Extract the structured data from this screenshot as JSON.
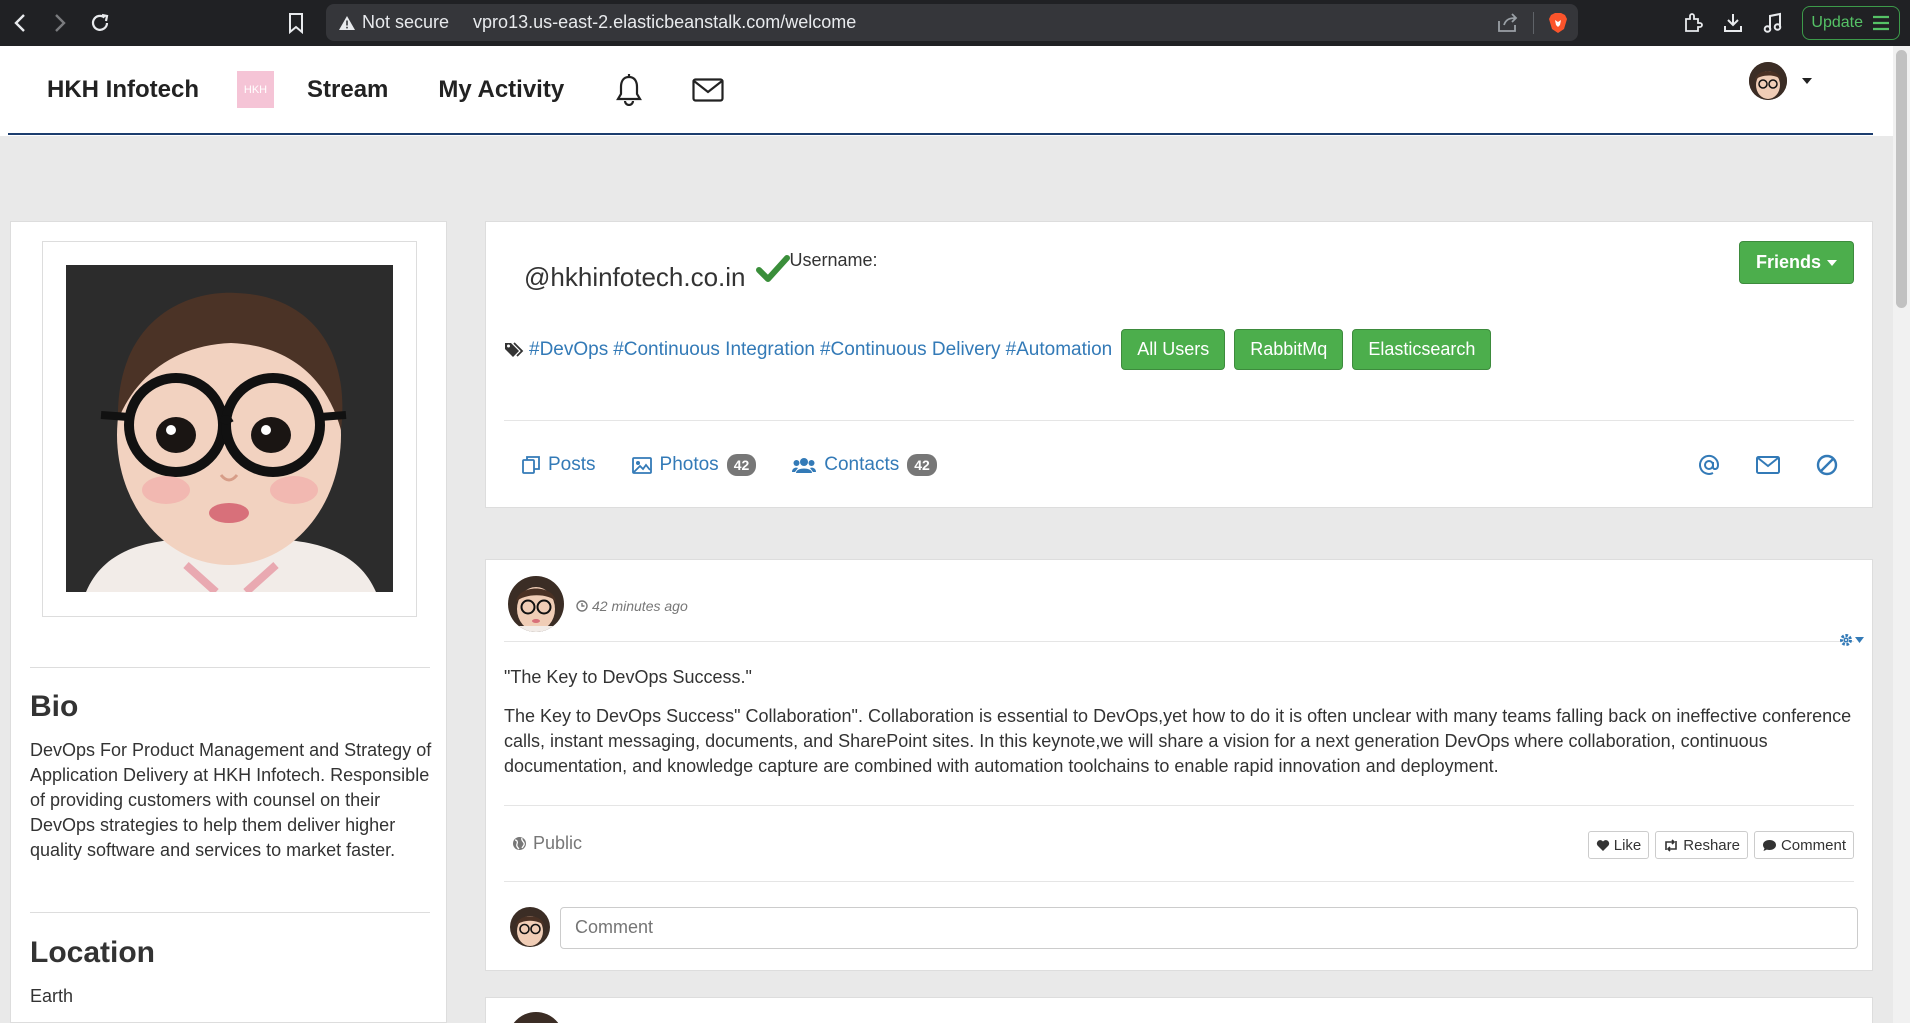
{
  "browser": {
    "security_label": "Not secure",
    "url_host": "vpro13.us-east-2.elasticbeanstalk.com",
    "url_path": "/welcome",
    "update_label": "Update"
  },
  "nav": {
    "brand": "HKH Infotech",
    "logo_text": "HKH",
    "stream": "Stream",
    "my_activity": "My Activity"
  },
  "bio": {
    "title": "Bio",
    "text": "DevOps For Product Management and Strategy of Application Delivery at HKH Infotech. Responsible of providing customers with counsel on their DevOps strategies to help them deliver higher quality software and services to market faster."
  },
  "location": {
    "title": "Location",
    "value": "Earth"
  },
  "profile": {
    "handle": "@hkhinfotech.co.in",
    "username_label": "Username:",
    "friends_button": "Friends",
    "tags": [
      "#DevOps",
      "#Continuous Integration",
      "#Continuous Delivery",
      "#Automation"
    ],
    "aspects": [
      "All Users",
      "RabbitMq",
      "Elasticsearch"
    ],
    "tabs": {
      "posts": "Posts",
      "photos": "Photos",
      "photos_count": "42",
      "contacts": "Contacts",
      "contacts_count": "42"
    }
  },
  "post": {
    "time": "42 minutes ago",
    "title": "\"The Key to DevOps Success.\"",
    "body": "The Key to DevOps Success\" Collaboration\". Collaboration is essential to DevOps,yet how to do it is often unclear with many teams falling back on ineffective conference calls, instant messaging, documents, and SharePoint sites. In this keynote,we will share a vision for a next generation DevOps where collaboration, continuous documentation, and knowledge capture are combined with automation toolchains to enable rapid innovation and deployment.",
    "visibility": "Public",
    "like": "Like",
    "reshare": "Reshare",
    "comment": "Comment",
    "comment_placeholder": "Comment"
  },
  "colors": {
    "link": "#337ab7",
    "success": "#4cae4c",
    "nav_border": "#1c3d6e"
  }
}
